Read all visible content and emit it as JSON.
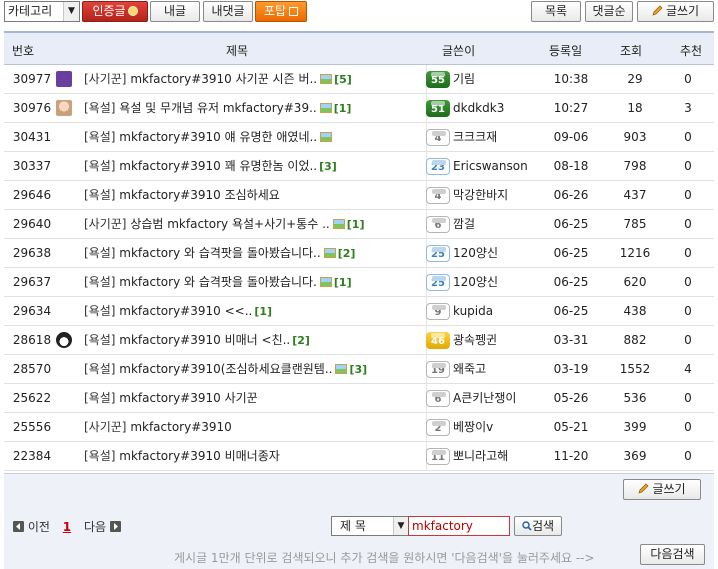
{
  "toolbar": {
    "category_label": "카테고리",
    "certified_label": "인증글",
    "my_posts_label": "내글",
    "my_comments_label": "내댓글",
    "poll_label": "포탑",
    "list_label": "목록",
    "comment_order_label": "댓글순",
    "write_label": "글쓰기"
  },
  "table": {
    "headers": {
      "no": "번호",
      "title": "제목",
      "writer": "글쓴이",
      "date": "등록일",
      "views": "조회",
      "recommend": "추천"
    },
    "rows": [
      {
        "no": "30977",
        "avatar": "v-icon",
        "category": "[사기꾼]",
        "title": "mkfactory#3910 사기꾼 시즌 버..",
        "image": true,
        "comments": "[5]",
        "level": "55",
        "level_style": "green",
        "writer": "기림",
        "date": "10:38",
        "views": "29",
        "recommend": "0"
      },
      {
        "no": "30976",
        "avatar": "photo-avatar",
        "category": "[욕설]",
        "title": "욕설 및 무개념 유저 mkfactory#39..",
        "image": true,
        "comments": "[1]",
        "level": "51",
        "level_style": "green",
        "writer": "dkdkdk3",
        "date": "10:27",
        "views": "18",
        "recommend": "3"
      },
      {
        "no": "30431",
        "avatar": "",
        "category": "[욕설]",
        "title": "mkfactory#3910 얘 유명한 애였네..",
        "image": true,
        "comments": "",
        "level": "4",
        "level_style": "white",
        "writer": "크크크재",
        "date": "09-06",
        "views": "903",
        "recommend": "0"
      },
      {
        "no": "30337",
        "avatar": "",
        "category": "[욕설]",
        "title": "mkfactory#3910 꽤 유명한놈 이었..",
        "image": false,
        "comments": "[3]",
        "level": "23",
        "level_style": "blue",
        "writer": "Ericswanson",
        "date": "08-18",
        "views": "798",
        "recommend": "0"
      },
      {
        "no": "29646",
        "avatar": "",
        "category": "[욕설]",
        "title": "mkfactory#3910 조심하세요",
        "image": false,
        "comments": "",
        "level": "4",
        "level_style": "white",
        "writer": "막강한바지",
        "date": "06-26",
        "views": "437",
        "recommend": "0"
      },
      {
        "no": "29640",
        "avatar": "",
        "category": "[사기꾼]",
        "title": "상습범 mkfactory 욕설+사기+통수 ..",
        "image": true,
        "comments": "[1]",
        "level": "6",
        "level_style": "white",
        "writer": "깜걸",
        "date": "06-25",
        "views": "785",
        "recommend": "0"
      },
      {
        "no": "29638",
        "avatar": "",
        "category": "[욕설]",
        "title": "mkfactory 와 습격팟을 돌아봤습니다..",
        "image": true,
        "comments": "[2]",
        "level": "25",
        "level_style": "blue",
        "writer": "120양신",
        "date": "06-25",
        "views": "1216",
        "recommend": "0"
      },
      {
        "no": "29637",
        "avatar": "",
        "category": "[욕설]",
        "title": "mkfactory 와 습격팟을 돌아봤습니다.",
        "image": true,
        "comments": "[1]",
        "level": "25",
        "level_style": "blue",
        "writer": "120양신",
        "date": "06-25",
        "views": "620",
        "recommend": "0"
      },
      {
        "no": "29634",
        "avatar": "",
        "category": "[욕설]",
        "title": "mkfactory#3910 <<..",
        "image": false,
        "comments": "[1]",
        "level": "9",
        "level_style": "white",
        "writer": "kupida",
        "date": "06-25",
        "views": "438",
        "recommend": "0"
      },
      {
        "no": "28618",
        "avatar": "penguin-avatar",
        "category": "[욕설]",
        "title": "mkfactory#3910 비매너 <친..",
        "image": false,
        "comments": "[2]",
        "level": "46",
        "level_style": "yellow",
        "writer": "광속펭귄",
        "date": "03-31",
        "views": "882",
        "recommend": "0"
      },
      {
        "no": "28570",
        "avatar": "",
        "category": "[욕설]",
        "title": "mkfactory#3910(조심하세요클랜원템..",
        "image": true,
        "comments": "[3]",
        "level": "19",
        "level_style": "white",
        "writer": "왜죽고",
        "date": "03-19",
        "views": "1552",
        "recommend": "4"
      },
      {
        "no": "25622",
        "avatar": "",
        "category": "[욕설]",
        "title": "mkfactory#3910 사기꾼",
        "image": false,
        "comments": "",
        "level": "6",
        "level_style": "white",
        "writer": "A큰키난쟁이",
        "date": "05-26",
        "views": "536",
        "recommend": "0"
      },
      {
        "no": "25556",
        "avatar": "",
        "category": "[사기꾼]",
        "title": "mkfactory#3910",
        "image": false,
        "comments": "",
        "level": "2",
        "level_style": "white",
        "writer": "베짱이v",
        "date": "05-21",
        "views": "399",
        "recommend": "0"
      },
      {
        "no": "22384",
        "avatar": "",
        "category": "[욕설]",
        "title": "mkfactory#3910 비매너종자",
        "image": false,
        "comments": "",
        "level": "11",
        "level_style": "white",
        "writer": "뽀니라고해",
        "date": "11-20",
        "views": "369",
        "component": "",
        "recommend": "0"
      }
    ]
  },
  "bottom": {
    "write_label": "글쓰기",
    "prev_label": "이전",
    "current_page": "1",
    "next_label": "다음",
    "search_field": "제 목",
    "search_value": "mkfactory",
    "search_label": "검색",
    "note": "게시글 1만개 단위로 검색되오니 추가 검색을 원하시면 '다음검색'을 눌러주세요 -->",
    "next_search_label": "다음검색"
  }
}
